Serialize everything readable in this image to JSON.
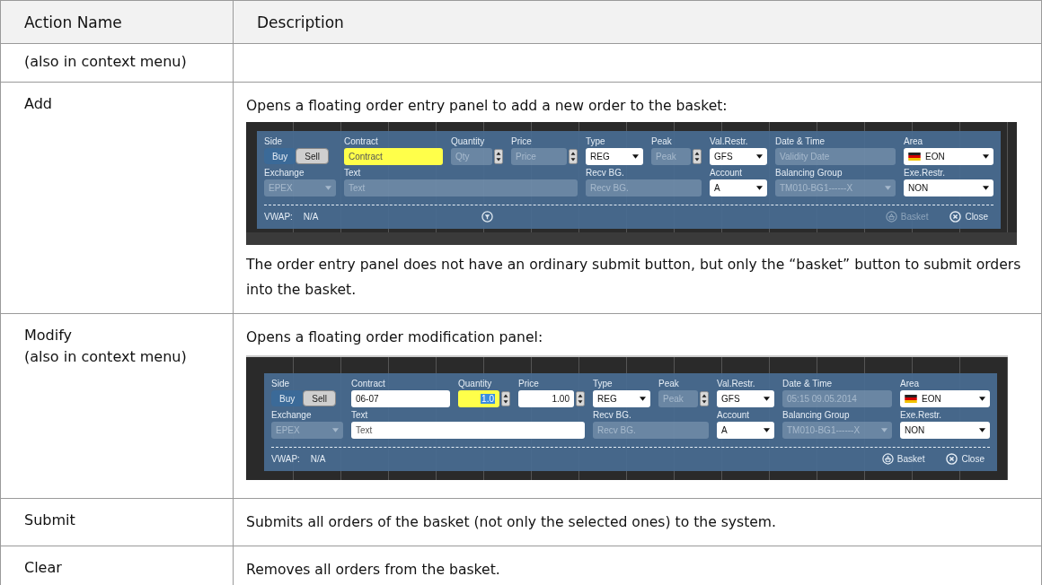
{
  "table": {
    "columns": [
      "Action Name",
      "Description"
    ],
    "rows": [
      {
        "name_lines": [
          "(also in context menu)"
        ],
        "description": []
      },
      {
        "name_lines": [
          "Add"
        ],
        "description": [
          {
            "kind": "text",
            "text": "Opens a floating order entry panel to add a new order to the basket:"
          },
          {
            "kind": "panel",
            "panel": {
              "side": [
                {
                  "label": "Buy",
                  "selected": true
                },
                {
                  "label": "Sell",
                  "selected": false
                }
              ],
              "side_label": "Side",
              "row1": [
                {
                  "label": "Contract",
                  "kind": "text",
                  "placeholder": "Contract",
                  "disabled": false,
                  "highlighted": true
                },
                {
                  "label": "Quantity",
                  "kind": "spin",
                  "placeholder": "Qty",
                  "disabled": true,
                  "highlighted": false
                },
                {
                  "label": "Price",
                  "kind": "spin",
                  "placeholder": "Price",
                  "disabled": true,
                  "highlighted": false
                },
                {
                  "label": "Type",
                  "kind": "combo",
                  "value": "REG",
                  "disabled": false,
                  "highlighted": false
                },
                {
                  "label": "Peak",
                  "kind": "spin",
                  "placeholder": "Peak",
                  "disabled": true,
                  "highlighted": false
                },
                {
                  "label": "Val.Restr.",
                  "kind": "combo",
                  "value": "GFS",
                  "disabled": false,
                  "highlighted": false
                },
                {
                  "label": "Date & Time",
                  "kind": "text",
                  "placeholder": "Validity Date",
                  "disabled": true,
                  "highlighted": false
                },
                {
                  "label": "Area",
                  "kind": "flag-combo",
                  "value": "EON",
                  "disabled": false,
                  "highlighted": false
                }
              ],
              "row2": [
                {
                  "label": "Exchange",
                  "kind": "combo",
                  "value": "EPEX",
                  "disabled": true,
                  "highlighted": false
                },
                {
                  "label": "Text",
                  "kind": "text",
                  "placeholder": "Text",
                  "disabled": true,
                  "highlighted": false
                },
                {
                  "label": "Recv BG.",
                  "kind": "text",
                  "placeholder": "Recv BG.",
                  "disabled": true,
                  "highlighted": false
                },
                {
                  "label": "Account",
                  "kind": "combo",
                  "value": "A",
                  "disabled": false,
                  "highlighted": false
                },
                {
                  "label": "Balancing Group",
                  "kind": "combo",
                  "value": "TM010-BG1------X",
                  "disabled": true,
                  "highlighted": false
                },
                {
                  "label": "Exe.Restr.",
                  "kind": "combo",
                  "value": "NON",
                  "disabled": false,
                  "highlighted": false
                }
              ],
              "vwap_label": "VWAP:",
              "vwap_value": "N/A",
              "filter": true,
              "basket": {
                "label": "Basket",
                "disabled": true
              },
              "close": "Close"
            }
          },
          {
            "kind": "text",
            "text": "The order entry panel does not have an ordinary submit button, but only the “basket” button to submit orders into the basket."
          }
        ]
      },
      {
        "name_lines": [
          "Modify",
          "(also in context menu)"
        ],
        "description": [
          {
            "kind": "text",
            "text": "Opens a floating order modification panel:"
          },
          {
            "kind": "panel",
            "panel": {
              "side": [
                {
                  "label": "Buy",
                  "selected": true
                },
                {
                  "label": "Sell",
                  "selected": false
                }
              ],
              "side_label": "Side",
              "row1": [
                {
                  "label": "Contract",
                  "kind": "text",
                  "value": "06-07",
                  "disabled": false,
                  "highlighted": false
                },
                {
                  "label": "Quantity",
                  "kind": "spin",
                  "value": "1.0",
                  "disabled": false,
                  "highlighted": true
                },
                {
                  "label": "Price",
                  "kind": "spin",
                  "value": "1.00",
                  "disabled": false,
                  "highlighted": false
                },
                {
                  "label": "Type",
                  "kind": "combo",
                  "value": "REG",
                  "disabled": false,
                  "highlighted": false
                },
                {
                  "label": "Peak",
                  "kind": "spin",
                  "placeholder": "Peak",
                  "disabled": true,
                  "highlighted": false
                },
                {
                  "label": "Val.Restr.",
                  "kind": "combo",
                  "value": "GFS",
                  "disabled": false,
                  "highlighted": false
                },
                {
                  "label": "Date & Time",
                  "kind": "text",
                  "value": "05:15 09.05.2014",
                  "disabled": true,
                  "highlighted": false
                },
                {
                  "label": "Area",
                  "kind": "flag-combo",
                  "value": "EON",
                  "disabled": false,
                  "highlighted": false
                }
              ],
              "row2": [
                {
                  "label": "Exchange",
                  "kind": "combo",
                  "value": "EPEX",
                  "disabled": true,
                  "highlighted": false
                },
                {
                  "label": "Text",
                  "kind": "text",
                  "placeholder": "Text",
                  "disabled": false,
                  "highlighted": false
                },
                {
                  "label": "Recv BG.",
                  "kind": "text",
                  "placeholder": "Recv BG.",
                  "disabled": true,
                  "highlighted": false
                },
                {
                  "label": "Account",
                  "kind": "combo",
                  "value": "A",
                  "disabled": false,
                  "highlighted": false
                },
                {
                  "label": "Balancing Group",
                  "kind": "combo",
                  "value": "TM010-BG1------X",
                  "disabled": true,
                  "highlighted": false
                },
                {
                  "label": "Exe.Restr.",
                  "kind": "combo",
                  "value": "NON",
                  "disabled": false,
                  "highlighted": false
                }
              ],
              "vwap_label": "VWAP:",
              "vwap_value": "N/A",
              "filter": false,
              "basket": {
                "label": "Basket",
                "disabled": false
              },
              "close": "Close"
            }
          }
        ]
      },
      {
        "name_lines": [
          "Submit"
        ],
        "description": [
          {
            "kind": "text",
            "text": "Submits all orders of the basket (not only the selected ones) to the system."
          }
        ]
      },
      {
        "name_lines": [
          "Clear"
        ],
        "description": [
          {
            "kind": "text",
            "text": "Removes all orders from the basket."
          }
        ]
      }
    ]
  }
}
